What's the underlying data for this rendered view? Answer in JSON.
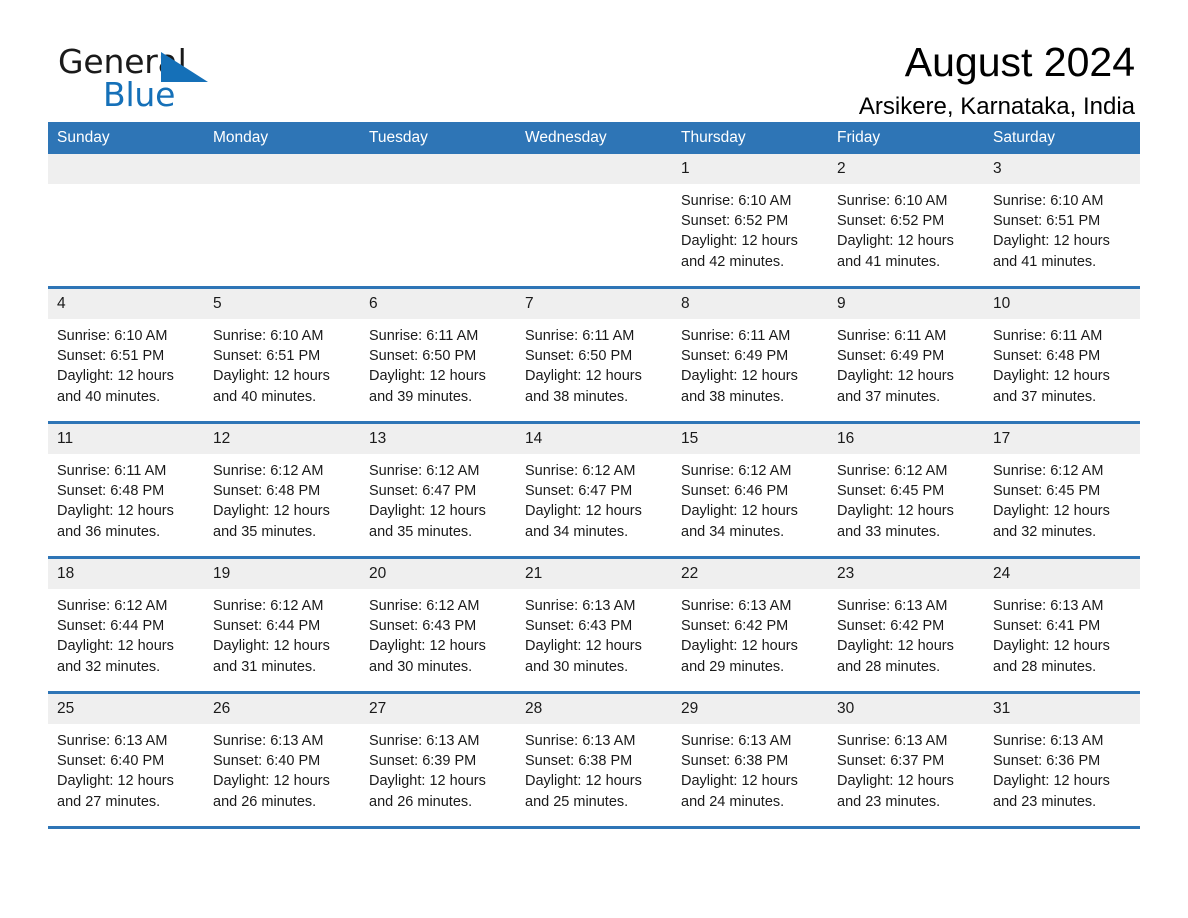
{
  "brand": {
    "name_part1": "General",
    "name_part2": "Blue",
    "triangle_color": "#1570b8"
  },
  "header": {
    "title": "August 2024",
    "subtitle": "Arsikere, Karnataka, India"
  },
  "theme": {
    "header_blue": "#2e75b6",
    "daynum_gray": "#efefef",
    "text_black": "#1a1a1a",
    "page_background": "#ffffff"
  },
  "calendar": {
    "weekday_headers": [
      "Sunday",
      "Monday",
      "Tuesday",
      "Wednesday",
      "Thursday",
      "Friday",
      "Saturday"
    ],
    "labels": {
      "sunrise_prefix": "Sunrise:",
      "sunset_prefix": "Sunset:",
      "daylight_prefix": "Daylight:"
    },
    "weeks": [
      [
        {
          "day": "",
          "empty": true
        },
        {
          "day": "",
          "empty": true
        },
        {
          "day": "",
          "empty": true
        },
        {
          "day": "",
          "empty": true
        },
        {
          "day": "1",
          "sunrise": "Sunrise: 6:10 AM",
          "sunset": "Sunset: 6:52 PM",
          "daylight": "Daylight: 12 hours and 42 minutes."
        },
        {
          "day": "2",
          "sunrise": "Sunrise: 6:10 AM",
          "sunset": "Sunset: 6:52 PM",
          "daylight": "Daylight: 12 hours and 41 minutes."
        },
        {
          "day": "3",
          "sunrise": "Sunrise: 6:10 AM",
          "sunset": "Sunset: 6:51 PM",
          "daylight": "Daylight: 12 hours and 41 minutes."
        }
      ],
      [
        {
          "day": "4",
          "sunrise": "Sunrise: 6:10 AM",
          "sunset": "Sunset: 6:51 PM",
          "daylight": "Daylight: 12 hours and 40 minutes."
        },
        {
          "day": "5",
          "sunrise": "Sunrise: 6:10 AM",
          "sunset": "Sunset: 6:51 PM",
          "daylight": "Daylight: 12 hours and 40 minutes."
        },
        {
          "day": "6",
          "sunrise": "Sunrise: 6:11 AM",
          "sunset": "Sunset: 6:50 PM",
          "daylight": "Daylight: 12 hours and 39 minutes."
        },
        {
          "day": "7",
          "sunrise": "Sunrise: 6:11 AM",
          "sunset": "Sunset: 6:50 PM",
          "daylight": "Daylight: 12 hours and 38 minutes."
        },
        {
          "day": "8",
          "sunrise": "Sunrise: 6:11 AM",
          "sunset": "Sunset: 6:49 PM",
          "daylight": "Daylight: 12 hours and 38 minutes."
        },
        {
          "day": "9",
          "sunrise": "Sunrise: 6:11 AM",
          "sunset": "Sunset: 6:49 PM",
          "daylight": "Daylight: 12 hours and 37 minutes."
        },
        {
          "day": "10",
          "sunrise": "Sunrise: 6:11 AM",
          "sunset": "Sunset: 6:48 PM",
          "daylight": "Daylight: 12 hours and 37 minutes."
        }
      ],
      [
        {
          "day": "11",
          "sunrise": "Sunrise: 6:11 AM",
          "sunset": "Sunset: 6:48 PM",
          "daylight": "Daylight: 12 hours and 36 minutes."
        },
        {
          "day": "12",
          "sunrise": "Sunrise: 6:12 AM",
          "sunset": "Sunset: 6:48 PM",
          "daylight": "Daylight: 12 hours and 35 minutes."
        },
        {
          "day": "13",
          "sunrise": "Sunrise: 6:12 AM",
          "sunset": "Sunset: 6:47 PM",
          "daylight": "Daylight: 12 hours and 35 minutes."
        },
        {
          "day": "14",
          "sunrise": "Sunrise: 6:12 AM",
          "sunset": "Sunset: 6:47 PM",
          "daylight": "Daylight: 12 hours and 34 minutes."
        },
        {
          "day": "15",
          "sunrise": "Sunrise: 6:12 AM",
          "sunset": "Sunset: 6:46 PM",
          "daylight": "Daylight: 12 hours and 34 minutes."
        },
        {
          "day": "16",
          "sunrise": "Sunrise: 6:12 AM",
          "sunset": "Sunset: 6:45 PM",
          "daylight": "Daylight: 12 hours and 33 minutes."
        },
        {
          "day": "17",
          "sunrise": "Sunrise: 6:12 AM",
          "sunset": "Sunset: 6:45 PM",
          "daylight": "Daylight: 12 hours and 32 minutes."
        }
      ],
      [
        {
          "day": "18",
          "sunrise": "Sunrise: 6:12 AM",
          "sunset": "Sunset: 6:44 PM",
          "daylight": "Daylight: 12 hours and 32 minutes."
        },
        {
          "day": "19",
          "sunrise": "Sunrise: 6:12 AM",
          "sunset": "Sunset: 6:44 PM",
          "daylight": "Daylight: 12 hours and 31 minutes."
        },
        {
          "day": "20",
          "sunrise": "Sunrise: 6:12 AM",
          "sunset": "Sunset: 6:43 PM",
          "daylight": "Daylight: 12 hours and 30 minutes."
        },
        {
          "day": "21",
          "sunrise": "Sunrise: 6:13 AM",
          "sunset": "Sunset: 6:43 PM",
          "daylight": "Daylight: 12 hours and 30 minutes."
        },
        {
          "day": "22",
          "sunrise": "Sunrise: 6:13 AM",
          "sunset": "Sunset: 6:42 PM",
          "daylight": "Daylight: 12 hours and 29 minutes."
        },
        {
          "day": "23",
          "sunrise": "Sunrise: 6:13 AM",
          "sunset": "Sunset: 6:42 PM",
          "daylight": "Daylight: 12 hours and 28 minutes."
        },
        {
          "day": "24",
          "sunrise": "Sunrise: 6:13 AM",
          "sunset": "Sunset: 6:41 PM",
          "daylight": "Daylight: 12 hours and 28 minutes."
        }
      ],
      [
        {
          "day": "25",
          "sunrise": "Sunrise: 6:13 AM",
          "sunset": "Sunset: 6:40 PM",
          "daylight": "Daylight: 12 hours and 27 minutes."
        },
        {
          "day": "26",
          "sunrise": "Sunrise: 6:13 AM",
          "sunset": "Sunset: 6:40 PM",
          "daylight": "Daylight: 12 hours and 26 minutes."
        },
        {
          "day": "27",
          "sunrise": "Sunrise: 6:13 AM",
          "sunset": "Sunset: 6:39 PM",
          "daylight": "Daylight: 12 hours and 26 minutes."
        },
        {
          "day": "28",
          "sunrise": "Sunrise: 6:13 AM",
          "sunset": "Sunset: 6:38 PM",
          "daylight": "Daylight: 12 hours and 25 minutes."
        },
        {
          "day": "29",
          "sunrise": "Sunrise: 6:13 AM",
          "sunset": "Sunset: 6:38 PM",
          "daylight": "Daylight: 12 hours and 24 minutes."
        },
        {
          "day": "30",
          "sunrise": "Sunrise: 6:13 AM",
          "sunset": "Sunset: 6:37 PM",
          "daylight": "Daylight: 12 hours and 23 minutes."
        },
        {
          "day": "31",
          "sunrise": "Sunrise: 6:13 AM",
          "sunset": "Sunset: 6:36 PM",
          "daylight": "Daylight: 12 hours and 23 minutes."
        }
      ]
    ]
  }
}
